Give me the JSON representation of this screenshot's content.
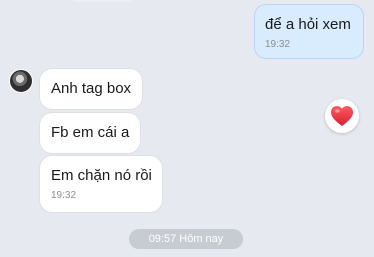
{
  "messages": {
    "outgoing": [
      {
        "text": "để a hỏi xem",
        "time": "19:32"
      }
    ],
    "incoming": [
      {
        "text": "Anh tag box"
      },
      {
        "text": "Fb em cái a"
      },
      {
        "text": "Em chặn nó rồi",
        "time": "19:32"
      }
    ]
  },
  "reaction": {
    "icon": "heart-icon",
    "color": "#e8323c"
  },
  "date_separator": "09:57 Hôm nay",
  "colors": {
    "background": "#e6e9ef",
    "outgoing_bubble": "#d8ecfe",
    "incoming_bubble": "#ffffff",
    "timestamp": "#8a8e95"
  }
}
